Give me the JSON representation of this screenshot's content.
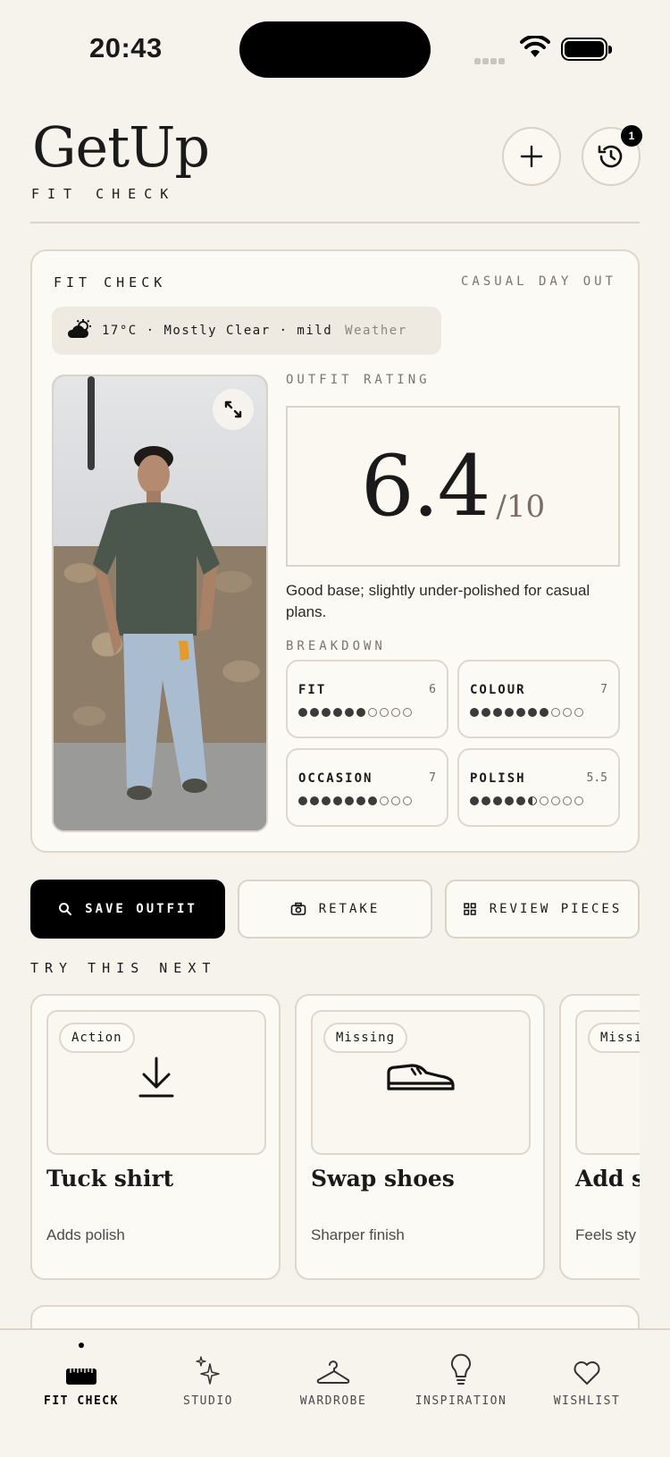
{
  "status_bar": {
    "time": "20:43"
  },
  "header": {
    "brand": "GetUp",
    "subtitle": "FIT CHECK",
    "history_badge": "1"
  },
  "fit_card": {
    "title": "FIT CHECK",
    "occasion": "CASUAL DAY OUT",
    "weather": {
      "text": "17°C · Mostly Clear · mild",
      "label": "Weather",
      "icon": "partly-cloudy-icon"
    },
    "rating": {
      "label": "OUTFIT RATING",
      "score": "6.4",
      "max": "/10",
      "verdict": "Good base; slightly under-polished for casual plans."
    },
    "breakdown": {
      "label": "BREAKDOWN",
      "metrics": [
        {
          "name": "FIT",
          "value": "6",
          "score": 6
        },
        {
          "name": "COLOUR",
          "value": "7",
          "score": 7
        },
        {
          "name": "OCCASION",
          "value": "7",
          "score": 7
        },
        {
          "name": "POLISH",
          "value": "5.5",
          "score": 5.5
        }
      ]
    }
  },
  "actions": {
    "save": "SAVE OUTFIT",
    "retake": "RETAKE",
    "review": "REVIEW PIECES"
  },
  "suggestions": {
    "label": "TRY THIS NEXT",
    "items": [
      {
        "tag": "Action",
        "title": "Tuck shirt",
        "desc": "Adds polish",
        "icon": "download-arrow-icon"
      },
      {
        "tag": "Missing",
        "title": "Swap shoes",
        "desc": "Sharper finish",
        "icon": "sneaker-icon"
      },
      {
        "tag": "Missing",
        "title": "Add st",
        "desc": "Feels sty",
        "icon": ""
      }
    ]
  },
  "tabbar": {
    "items": [
      {
        "label": "FIT CHECK",
        "icon": "scanner-icon",
        "active": true
      },
      {
        "label": "STUDIO",
        "icon": "sparkles-icon"
      },
      {
        "label": "WARDROBE",
        "icon": "hanger-icon"
      },
      {
        "label": "INSPIRATION",
        "icon": "lightbulb-icon"
      },
      {
        "label": "WISHLIST",
        "icon": "heart-icon"
      }
    ]
  },
  "colors": {
    "background": "#f6f2ec",
    "card": "#fcfaf5",
    "border": "#ddd7cd",
    "primary": "#000000",
    "muted": "#7a756d"
  }
}
